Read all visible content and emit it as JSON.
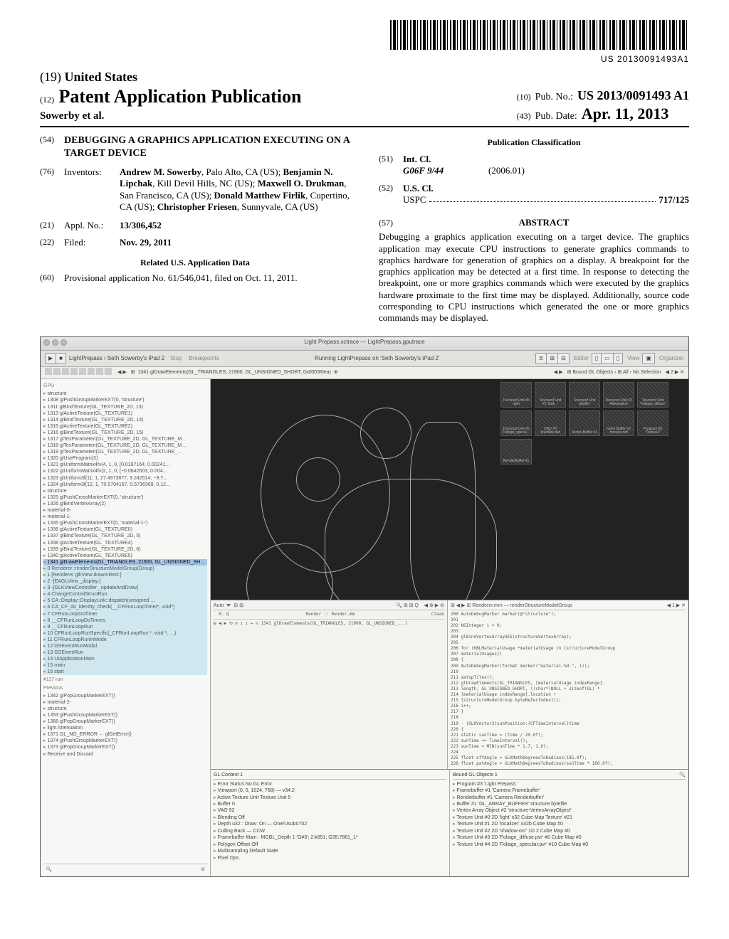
{
  "barcode_number": "US 20130091493A1",
  "header": {
    "country_num": "(19)",
    "country": "United States",
    "doc_num": "(12)",
    "doc_type": "Patent Application Publication",
    "authors_line": "Sowerby et al.",
    "pubno_num": "(10)",
    "pubno_lbl": "Pub. No.:",
    "pubno": "US 2013/0091493 A1",
    "pubdate_num": "(43)",
    "pubdate_lbl": "Pub. Date:",
    "pubdate": "Apr. 11, 2013"
  },
  "left_fields": {
    "title_num": "(54)",
    "title": "DEBUGGING A GRAPHICS APPLICATION EXECUTING ON A TARGET DEVICE",
    "inv_num": "(76)",
    "inv_lbl": "Inventors:",
    "inventors_html": "Andrew M. Sowerby, Palo Alto, CA (US); Benjamin N. Lipchak, Kill Devil Hills, NC (US); Maxwell O. Drukman, San Francisco, CA (US); Donald Matthew Firlik, Cupertino, CA (US); Christopher Friesen, Sunnyvale, CA (US)",
    "appl_num_lbl": "(21)",
    "appl_lbl": "Appl. No.:",
    "appl_no": "13/306,452",
    "filed_num": "(22)",
    "filed_lbl": "Filed:",
    "filed": "Nov. 29, 2011",
    "related_heading": "Related U.S. Application Data",
    "prov_num": "(60)",
    "prov": "Provisional application No. 61/546,041, filed on Oct. 11, 2011."
  },
  "right_fields": {
    "pubclass_heading": "Publication Classification",
    "intcl_num": "(51)",
    "intcl_lbl": "Int. Cl.",
    "intcl_code": "G06F 9/44",
    "intcl_year": "(2006.01)",
    "uscl_num": "(52)",
    "uscl_lbl": "U.S. Cl.",
    "uspc_lbl": "USPC",
    "uspc_code": "717/125",
    "abstract_num": "(57)",
    "abstract_heading": "ABSTRACT",
    "abstract": "Debugging a graphics application executing on a target device. The graphics application may execute CPU instructions to generate graphics commands to graphics hardware for generation of graphics on a display. A breakpoint for the graphics application may be detected at a first time. In response to detecting the breakpoint, one or more graphics commands which were executed by the graphics hardware proximate to the first time may be displayed. Additionally, source code corresponding to CPU instructions which generated the one or more graphics commands may be displayed."
  },
  "figure": {
    "window_title": "Light Prepass.xctrace — LightPrepass.gputrace",
    "toolbar": {
      "scheme": "LightPrepass › Seth Sowerby's iPad 2",
      "status": "Running LightPrepass on 'Seth Sowerby's iPad 2'",
      "stop": "Stop",
      "breakpoints": "Breakpoints",
      "editor": "Editor",
      "view": "View",
      "organizer": "Organizer"
    },
    "subtool_path": "1341 glDrawElements(GL_TRIANGLES, 21900, GL_UNSIGNED_SHORT, 0x0003f0ea)",
    "subtool_right": [
      "Bound GL Objects",
      "All",
      "No Selection"
    ],
    "left_tree": {
      "root": "GPU",
      "sections": [
        "structure",
        "  1308 glPushGroupMarkerEXT(0, 'structure')",
        "  1311 glBindTexture(GL_TEXTURE_2D, 13)",
        "  1313 glActiveTexture(GL_TEXTURE1)",
        "  1314 glBindTexture(GL_TEXTURE_2D, 14)",
        "  1315 glActiveTexture(GL_TEXTURE2)",
        "  1316 glBindTexture(GL_TEXTURE_2D, 15)",
        "  1317 glTexParameteri(GL_TEXTURE_2D, GL_TEXTURE_M...",
        "  1318 glTexParameteri(GL_TEXTURE_2D, GL_TEXTURE_M...",
        "  1319 glTexParameteri(GL_TEXTURE_2D, GL_TEXTURE_...",
        "  1320 glUseProgram(3)",
        "  1321 glUniformMatrix4fv(4, 1, 0, [0.0187164, 0.00241...",
        "  1322 glUniformMatrix4fv(2, 1, 0, [−0.0642603, 0·004...",
        "  1323 glUniform3f(11, 1, 27.4973877, 3·242514, −9.7...",
        "  1324 glUniform3f(12, 1, 70.5704167, 0.5736369, 0.12...",
        "structure",
        "  1325 glPushCrossMarkerEXT(0, 'structure')",
        "  1326 glBindVertexArray(2)",
        "material-0-",
        "material-1-",
        "  1335 glPushCrossMarkerEXT(0, 'material-1-')",
        "  1336 glActiveTexture(GL_TEXTURE0)",
        "  1337 glBindTexture(GL_TEXTURE_2D, 5)",
        "  1338 glActiveTexture(GL_TEXTURE4)",
        "  1339 glBindTexture(GL_TEXTURE_2D, 6)",
        "  1340 glActiveTexture(GL_TEXTURE5)"
      ],
      "selected": "  1341 glDrawElements(GL_TRIANGLES, 21900, GL_UNSIGNED_SHORT, 0x0003f0ea)",
      "cyan_rows": [
        "0  Renderer::renderStructureModelGroup(Group)",
        "1  [Renderer glkView:drawInRect:]",
        "2  -[EAGLView _display:]",
        "3  -[GLKViewController _updateAndDraw]",
        "4  ChangeControlStructRun",
        "5  CA::Display::DisplayLink::dispatch(unsigned …",
        "6  CA_CF_do_identity_check(__CFRunLoopTimer*, void*)",
        "7  CFRunLoopDoTimer",
        "8  __CFRunLoopDoTimers",
        "9  __CFRunLoopRun",
        "10 CFRunLoopRunSpecific(_CFRunLoopRun *, void *, …)",
        "11 CFRunLoopRunInMode",
        "12 GSEventRunModal",
        "13 GSEventRun",
        "14 UIApplicationMain",
        "15 main",
        "16 start"
      ],
      "footer_section": "#117 run",
      "previous": "Previous",
      "more_rows": [
        "1342 glPopGroupMarkerEXT()",
        "material-2-",
        "structure",
        "  1353 glPushGroupMarkerEXT()",
        "  1368 glPopGroupMarkerEXT()",
        "light Attenuation",
        "  1371 GL_NO_ERROR ← glGetError()",
        "  1374 glPushGroupMarkerEXT()",
        "  1373 glPopGroupMarkerEXT()",
        "Receive and Discard"
      ]
    },
    "thumbs": [
      {
        "lbl1": "Texcoord Unit #0",
        "lbl2": "right"
      },
      {
        "lbl1": "Texcoord Unit",
        "lbl2": "#1 'look...'"
      },
      {
        "lbl1": "Texcoord Unit",
        "lbl2": "'gbuffer'"
      },
      {
        "lbl1": "Texcoord Unit #3",
        "lbl2": "'Attenuation'"
      },
      {
        "lbl1": "Texcoord Unit",
        "lbl2": "'Foliage_diffuse'"
      },
      {
        "lbl1": "Texcoord Unit #5",
        "lbl2": "'Foliage_specul...'"
      },
      {
        "lbl1": "UBO #0",
        "lbl2": "'shedlike.dat'"
      },
      {
        "lbl1": "Vertex Buffer #1",
        "lbl2": ""
      },
      {
        "lbl1": "Index Buffer #2",
        "lbl2": "'moveto.dat'"
      },
      {
        "lbl1": "Program #3",
        "lbl2": "'Texture2'"
      },
      {
        "lbl1": "RenderBuffer #1",
        "lbl2": ""
      }
    ],
    "code_left_header": {
      "auto": "Auto",
      "scope": "Render :: Render.mm"
    },
    "code_right_header": "Renderer.mm — renderStructureModelGroup",
    "code_right_body": [
      "AutoDebugMarker marker(@\"structure\");",
      "",
      "NSInteger i = 0;",
      "",
      "glBindVertexArrayOES(structureVertexArray);",
      "",
      "for (KBLMaterialUsage *materialUsage in [structureModelGroup",
      "    materialUsages])",
      "{",
      "    AutoDebugMarker(format marker(\"material-%d-\", i));",
      "",
      "    setupTiles();",
      "    glDrawElements(GL_TRIANGLES, [materialUsage indexRange].",
      "        length, GL_UNSIGNED_SHORT, ((char*)NULL + sizeof(GL) *",
      "        [materialUsage indexRange].location +",
      "        [structureModelGroup byteReferIndex]));",
      "    i++;",
      "}",
      "",
      "- (GLKVector3)sunPosition:(CFTimeInterval)time",
      "{",
      "    static sunTime = (time / 20.0f);",
      "    sunTime += TimeInterval();",
      "    sunTime = MIN(sunTime * 1.7, 1.0);",
      "",
      "    float offAngle = GLKMathDegreesToRadians(185.0f);",
      "    float patAngle = GLKMathDegreesToRadians(sunTime * 160.0f);"
    ],
    "bottom_left_tree": {
      "hdr": "GL Context 1",
      "rows": [
        "Error Status No GL Error",
        "Viewport (0, 0, 1024, 768) — v34.2",
        "Active Texture Unit Texture Unit 5",
        "Buffer 0",
        "VAO 92",
        "Blending Off",
        "Depth u32 : Draw: On — One/Usub0702",
        "Culling Back — CCW",
        "Framebuffer Main : MGBL_Depth 1 'G#3'; 2:k851; G35:7861_1*",
        "Polygon Offset Off",
        "Multisampling Default State",
        "Pixel Ops"
      ]
    },
    "bottom_right_tree": {
      "hdr": "Bound GL Objects 1",
      "rows": [
        "Program #3 'Light Prepass'",
        "Framebuffer #1 'Camera Framebuffer'",
        "Renderbuffer #1 'Camera Renderbuffer'",
        "Buffer #1 'GL_ARRAY_BUFFER' structure.bytefile",
        "Vertex Array Object #2 'structure-VertexArrayObject'",
        "Texture Unit #0 2D 'light' x32 Cube Map Texture' #21",
        "Texture Unit #1 2D 'localizer' x32b Cube Map #0",
        "Texture Unit #2 2D 'shadow-orc' 1D 2 Cube Map #0",
        "Texture Unit #3 2D 'Foliage_diffuse.pvr' #6 Cube Map #0",
        "Texture Unit #4 2D 'Foliage_specular.pvr' #10 Cube Map #0"
      ]
    },
    "bottom_bar_path": "1341 glDrawElements(GL_TRIANGLES, 21900, GL_UNSIGNED_...)"
  }
}
